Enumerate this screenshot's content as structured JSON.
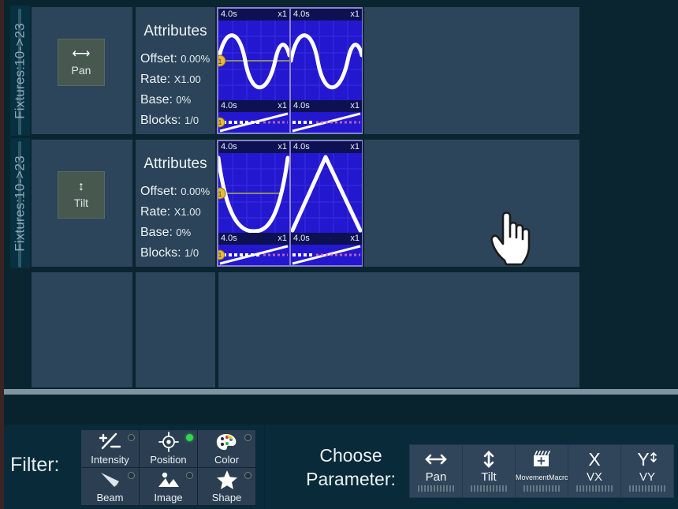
{
  "app": {
    "accent_blue": "#2318cf",
    "panel_bg": "#2c455a",
    "toolbar_bg": "#092a39"
  },
  "editor": {
    "rows": [
      {
        "fixtures_label": "Fixtures:10->23",
        "parameter": {
          "label": "Pan",
          "icon": "horizontal-arrows-icon"
        },
        "attributes": {
          "title": "Attributes",
          "offset_label": "Offset:",
          "offset_value": "0.00%",
          "rate_label": "Rate:",
          "rate_value": "X1.00",
          "base_label": "Base:",
          "base_value": "0%",
          "blocks_label": "Blocks:",
          "blocks_value": "1/0"
        },
        "waveforms": [
          {
            "time": "4.0s",
            "multiplier": "x1",
            "shape": "sine",
            "size": "big"
          },
          {
            "time": "4.0s",
            "multiplier": "x1",
            "shape": "sine-offset",
            "size": "big"
          },
          {
            "time": "4.0s",
            "multiplier": "x1",
            "shape": "ramp",
            "size": "small"
          },
          {
            "time": "4.0s",
            "multiplier": "x1",
            "shape": "ramp",
            "size": "small"
          }
        ]
      },
      {
        "fixtures_label": "Fixtures:10->23",
        "parameter": {
          "label": "Tilt",
          "icon": "vertical-arrows-icon"
        },
        "attributes": {
          "title": "Attributes",
          "offset_label": "Offset:",
          "offset_value": "0.00%",
          "rate_label": "Rate:",
          "rate_value": "X1.00",
          "base_label": "Base:",
          "base_value": "0%",
          "blocks_label": "Blocks:",
          "blocks_value": "1/0"
        },
        "waveforms": [
          {
            "time": "4.0s",
            "multiplier": "x1",
            "shape": "cosine-dip",
            "size": "big"
          },
          {
            "time": "4.0s",
            "multiplier": "x1",
            "shape": "triangle",
            "size": "big"
          },
          {
            "time": "4.0s",
            "multiplier": "x1",
            "shape": "ramp",
            "size": "small"
          },
          {
            "time": "4.0s",
            "multiplier": "x1",
            "shape": "ramp",
            "size": "small"
          }
        ]
      }
    ]
  },
  "toolbar": {
    "filter": {
      "label": "Filter:",
      "buttons": [
        {
          "label": "Intensity",
          "icon": "plus-minus-icon",
          "active": false
        },
        {
          "label": "Position",
          "icon": "crosshair-icon",
          "active": true
        },
        {
          "label": "Color",
          "icon": "palette-icon",
          "active": false
        },
        {
          "label": "Beam",
          "icon": "beam-cone-icon",
          "active": false
        },
        {
          "label": "Image",
          "icon": "picture-icon",
          "active": false
        },
        {
          "label": "Shape",
          "icon": "star-icon",
          "active": false
        }
      ]
    },
    "choose_parameter": {
      "label_line1": "Choose",
      "label_line2": "Parameter:",
      "buttons": [
        {
          "label": "Pan",
          "icon": "horizontal-arrows-icon"
        },
        {
          "label": "Tilt",
          "icon": "vertical-arrows-icon"
        },
        {
          "label": "MovementMacro",
          "icon": "clapperboard-icon"
        },
        {
          "label": "VX",
          "icon": "x-letter-icon"
        },
        {
          "label": "VY",
          "icon": "y-letter-icon"
        }
      ]
    }
  },
  "cursor": {
    "icon": "pointing-hand-cursor"
  }
}
